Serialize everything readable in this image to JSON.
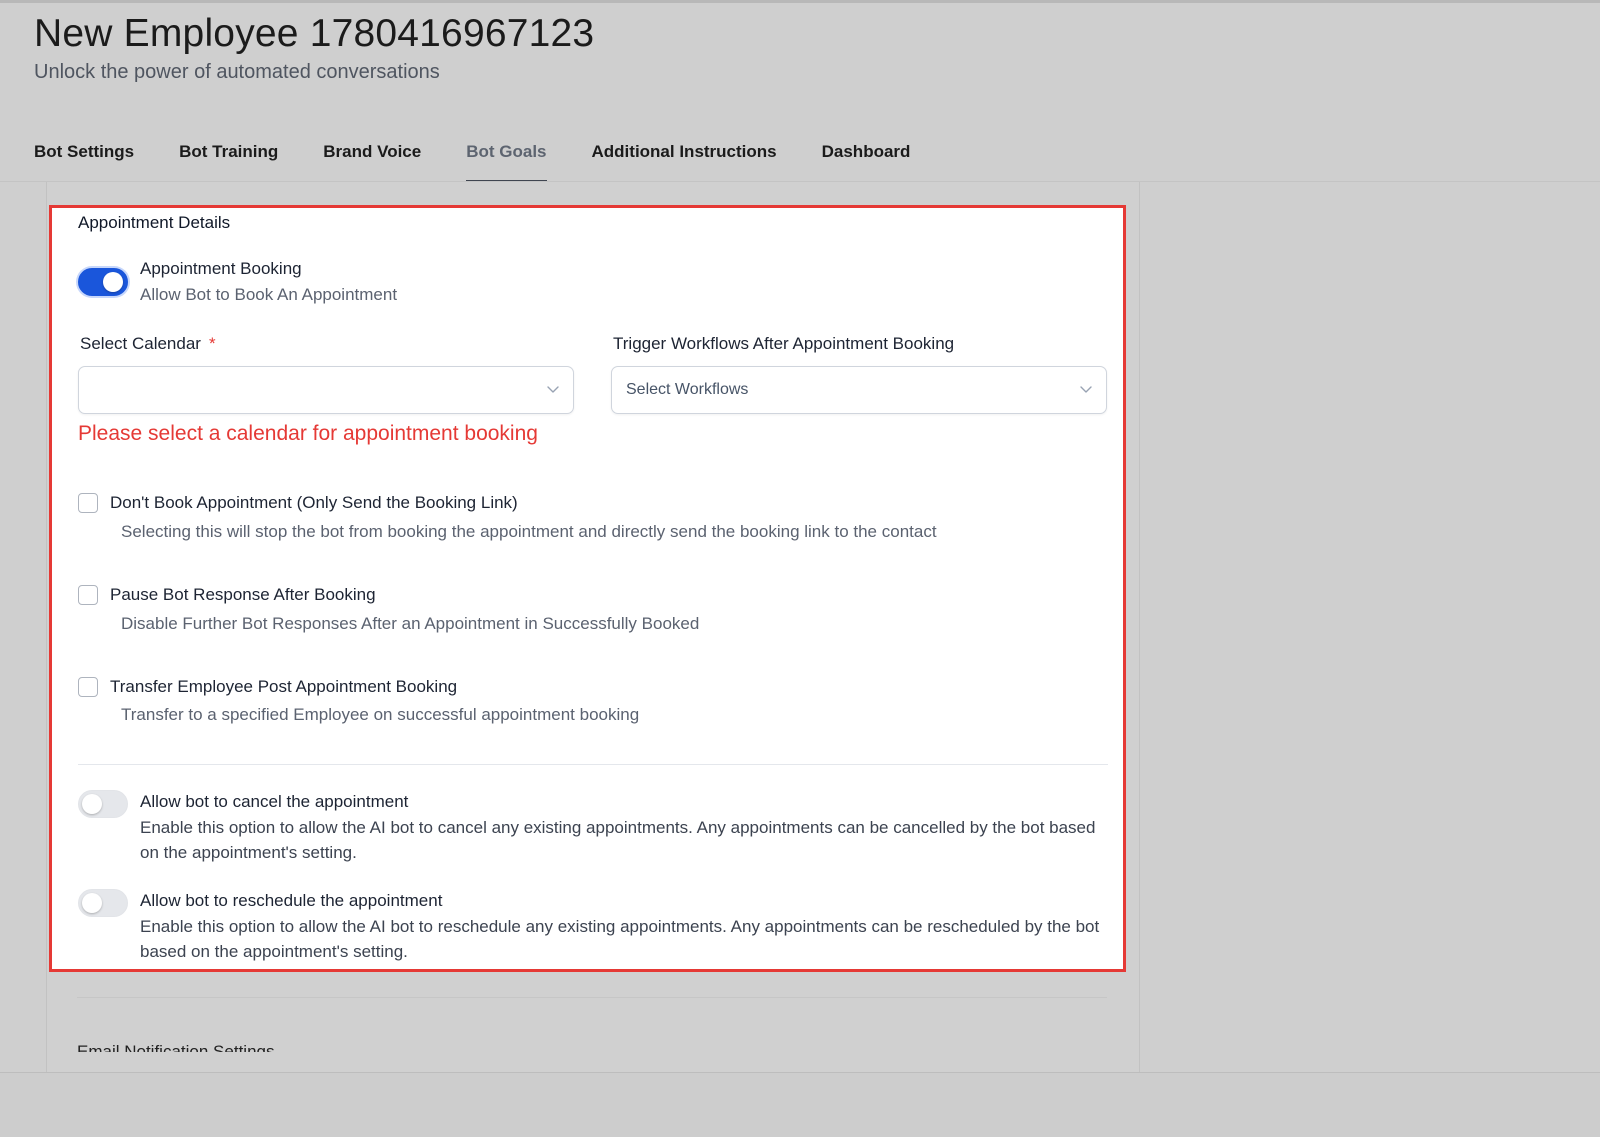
{
  "header": {
    "title": "New Employee 1780416967123",
    "subtitle": "Unlock the power of automated conversations"
  },
  "tabs": [
    {
      "label": "Bot Settings",
      "active": false
    },
    {
      "label": "Bot Training",
      "active": false
    },
    {
      "label": "Brand Voice",
      "active": false
    },
    {
      "label": "Bot Goals",
      "active": true
    },
    {
      "label": "Additional Instructions",
      "active": false
    },
    {
      "label": "Dashboard",
      "active": false
    }
  ],
  "appointment": {
    "section_title": "Appointment Details",
    "booking": {
      "label": "Appointment Booking",
      "description": "Allow Bot to Book An Appointment",
      "enabled": true
    },
    "calendar": {
      "label": "Select Calendar",
      "required_mark": "*",
      "value": "",
      "error": "Please select a calendar for appointment booking"
    },
    "workflows": {
      "label": "Trigger Workflows After Appointment Booking",
      "placeholder": "Select Workflows"
    },
    "options": [
      {
        "label": "Don't Book Appointment (Only Send the Booking Link)",
        "description": "Selecting this will stop the bot from booking the appointment and directly send the booking link to the contact",
        "checked": false
      },
      {
        "label": "Pause Bot Response After Booking",
        "description": "Disable Further Bot Responses After an Appointment in Successfully Booked",
        "checked": false
      },
      {
        "label": "Transfer Employee Post Appointment Booking",
        "description": "Transfer to a specified Employee on successful appointment booking",
        "checked": false
      }
    ],
    "cancel": {
      "label": "Allow bot to cancel the appointment",
      "description": "Enable this option to allow the AI bot to cancel any existing appointments. Any appointments can be cancelled by the bot based on the appointment's setting.",
      "enabled": false
    },
    "reschedule": {
      "label": "Allow bot to reschedule the appointment",
      "description": "Enable this option to allow the AI bot to reschedule any existing appointments. Any appointments can be rescheduled by the bot based on the appointment's setting.",
      "enabled": false
    }
  },
  "email_section": {
    "title": "Email Notification Settings"
  },
  "colors": {
    "accent": "#1a56db",
    "error": "#e53935",
    "highlight_border": "#e53935"
  }
}
